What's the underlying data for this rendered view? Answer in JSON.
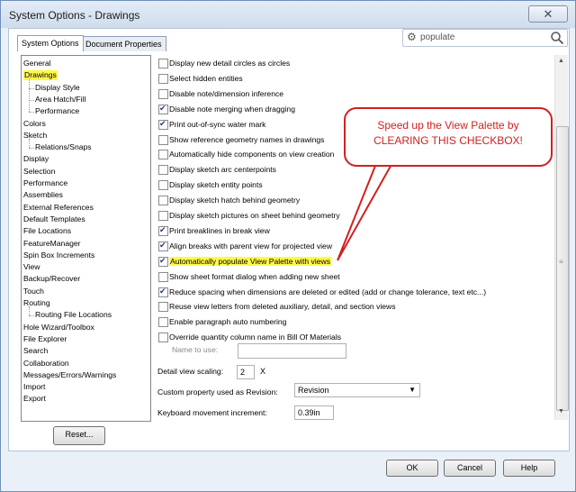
{
  "window": {
    "title": "System Options - Drawings",
    "close_glyph": "✕"
  },
  "tabs": [
    {
      "label": "System Options",
      "active": true
    },
    {
      "label": "Document Properties",
      "active": false
    }
  ],
  "search": {
    "value": "populate",
    "icon": "gear-icon",
    "search_icon": "magnifier-icon"
  },
  "tree": [
    {
      "label": "General",
      "indent": 0
    },
    {
      "label": "Drawings",
      "indent": 0,
      "selected": true
    },
    {
      "label": "Display Style",
      "indent": 1
    },
    {
      "label": "Area Hatch/Fill",
      "indent": 1
    },
    {
      "label": "Performance",
      "indent": 1
    },
    {
      "label": "Colors",
      "indent": 0
    },
    {
      "label": "Sketch",
      "indent": 0
    },
    {
      "label": "Relations/Snaps",
      "indent": 1
    },
    {
      "label": "Display",
      "indent": 0
    },
    {
      "label": "Selection",
      "indent": 0
    },
    {
      "label": "Performance",
      "indent": 0
    },
    {
      "label": "Assemblies",
      "indent": 0
    },
    {
      "label": "External References",
      "indent": 0
    },
    {
      "label": "Default Templates",
      "indent": 0
    },
    {
      "label": "File Locations",
      "indent": 0
    },
    {
      "label": "FeatureManager",
      "indent": 0
    },
    {
      "label": "Spin Box Increments",
      "indent": 0
    },
    {
      "label": "View",
      "indent": 0
    },
    {
      "label": "Backup/Recover",
      "indent": 0
    },
    {
      "label": "Touch",
      "indent": 0
    },
    {
      "label": "Routing",
      "indent": 0
    },
    {
      "label": "Routing File Locations",
      "indent": 1
    },
    {
      "label": "Hole Wizard/Toolbox",
      "indent": 0
    },
    {
      "label": "File Explorer",
      "indent": 0
    },
    {
      "label": "Search",
      "indent": 0
    },
    {
      "label": "Collaboration",
      "indent": 0
    },
    {
      "label": "Messages/Errors/Warnings",
      "indent": 0
    },
    {
      "label": "Import",
      "indent": 0
    },
    {
      "label": "Export",
      "indent": 0
    }
  ],
  "options": [
    {
      "label": "Display new detail circles as circles",
      "checked": false
    },
    {
      "label": "Select hidden entities",
      "checked": false
    },
    {
      "label": "Disable note/dimension inference",
      "checked": false
    },
    {
      "label": "Disable note merging when dragging",
      "checked": true
    },
    {
      "label": "Print out-of-sync water mark",
      "checked": true
    },
    {
      "label": "Show reference geometry names in drawings",
      "checked": false
    },
    {
      "label": "Automatically hide components on view creation",
      "checked": false
    },
    {
      "label": "Display sketch arc centerpoints",
      "checked": false
    },
    {
      "label": "Display sketch entity points",
      "checked": false
    },
    {
      "label": "Display sketch hatch behind geometry",
      "checked": false
    },
    {
      "label": "Display sketch pictures on sheet behind geometry",
      "checked": false
    },
    {
      "label": "Print breaklines in break view",
      "checked": true
    },
    {
      "label": "Align breaks with parent view for projected view",
      "checked": true
    },
    {
      "label": "Automatically populate View Palette with views",
      "checked": true,
      "highlight": true
    },
    {
      "label": "Show sheet format dialog when adding new sheet",
      "checked": false
    },
    {
      "label": "Reduce spacing when dimensions are deleted or edited (add or change tolerance, text etc...)",
      "checked": true
    },
    {
      "label": "Reuse view letters from deleted auxiliary, detail, and section views",
      "checked": false
    },
    {
      "label": "Enable paragraph auto numbering",
      "checked": false
    },
    {
      "label": "Override quantity column name in Bill Of Materials",
      "checked": false
    }
  ],
  "name_to_use": {
    "label": "Name to use:",
    "value": ""
  },
  "detail_scaling": {
    "label": "Detail view scaling:",
    "value": "2",
    "unit": "X"
  },
  "revision": {
    "label": "Custom property used as Revision:",
    "value": "Revision"
  },
  "keyboard": {
    "label": "Keyboard movement increment:",
    "value": "0.39in"
  },
  "callout": {
    "line1": "Speed up the View Palette by",
    "line2": "CLEARING THIS CHECKBOX!"
  },
  "buttons": {
    "reset": "Reset...",
    "ok": "OK",
    "cancel": "Cancel",
    "help": "Help"
  }
}
